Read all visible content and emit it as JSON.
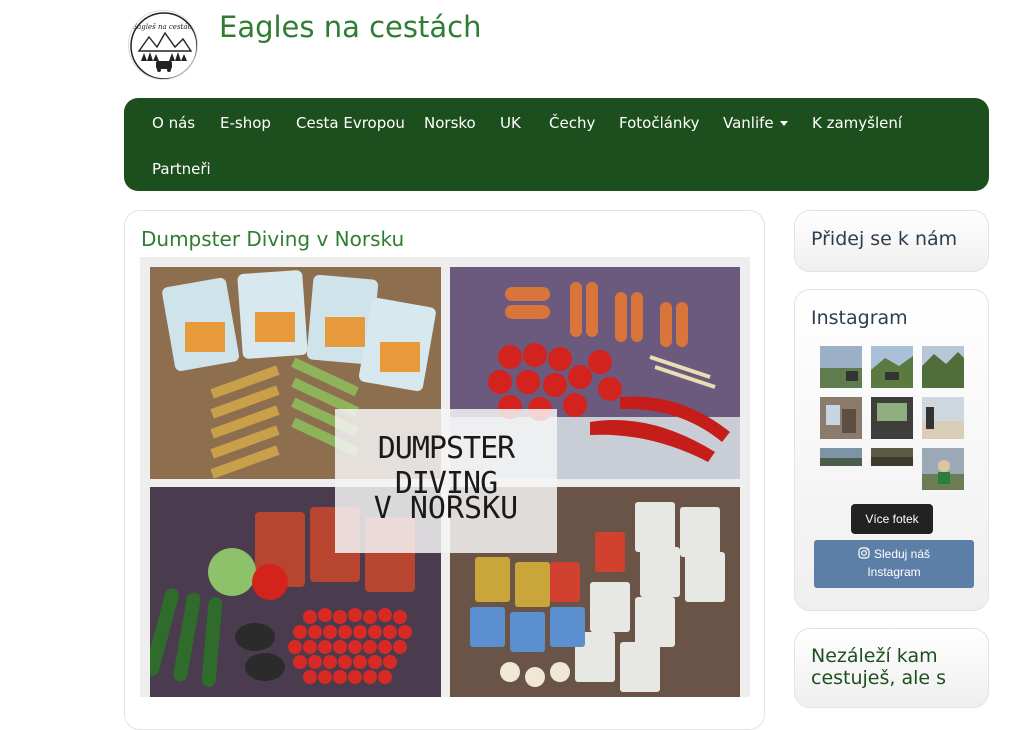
{
  "site": {
    "title": "Eagles na cestách",
    "logo_text": "Eagleš na cestách"
  },
  "nav": {
    "items": [
      "O nás",
      "E-shop",
      "Cesta Evropou",
      "Norsko",
      "UK",
      "Čechy",
      "Fotočlánky",
      "Vanlife",
      "K zamyšlení",
      "Partneři"
    ]
  },
  "post": {
    "title": "Dumpster Diving v Norsku",
    "image_text_line1": "DUMPSTER DIVING",
    "image_text_line2": "V NORSKU"
  },
  "sidebar": {
    "join_title": "Přidej se k nám",
    "instagram_title": "Instagram",
    "more_photos": "Více fotek",
    "follow_line1": "Sleduj náš",
    "follow_line2": "Instagram",
    "quote_line1": "Nezáleží kam",
    "quote_line2": "cestuješ, ale s"
  },
  "colors": {
    "nav_bg": "#1d4e1d",
    "title_green": "#2e7d32",
    "follow_button": "#5b7fa6"
  }
}
